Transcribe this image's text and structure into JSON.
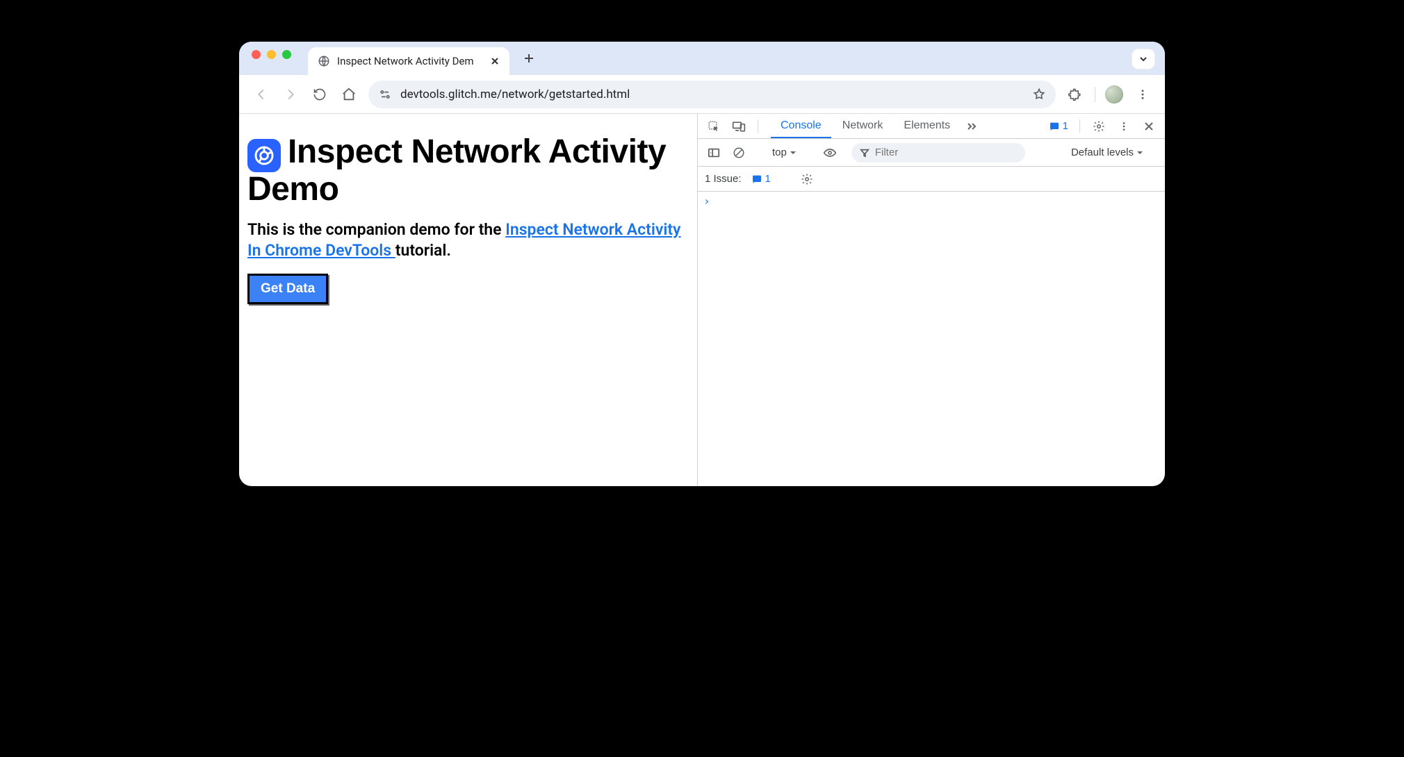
{
  "tabstrip": {
    "active_tab_title": "Inspect Network Activity Dem"
  },
  "toolbar": {
    "url": "devtools.glitch.me/network/getstarted.html"
  },
  "page": {
    "heading": "Inspect Network Activity Demo",
    "intro_pre": "This is the companion demo for the ",
    "intro_link": "Inspect Network Activity In Chrome DevTools ",
    "intro_post": "tutorial.",
    "button_label": "Get Data"
  },
  "devtools": {
    "tabs": {
      "console": "Console",
      "network": "Network",
      "elements": "Elements"
    },
    "issue_count": "1",
    "console_bar": {
      "context": "top",
      "filter_placeholder": "Filter",
      "levels": "Default levels"
    },
    "issue_row": {
      "label": "1 Issue:",
      "count": "1"
    }
  }
}
